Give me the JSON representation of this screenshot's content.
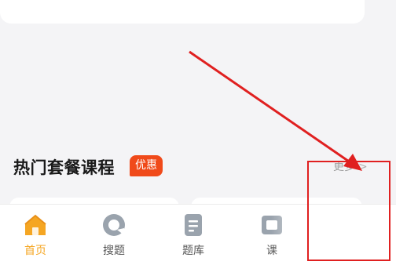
{
  "section": {
    "title": "热门套餐课程",
    "badge": "优惠",
    "more_label": "更多",
    "more_chevron": ">"
  },
  "tabs": [
    {
      "label": "首页",
      "icon": "home-icon",
      "active": true
    },
    {
      "label": "搜题",
      "icon": "search-ring-icon",
      "active": false
    },
    {
      "label": "题库",
      "icon": "document-icon",
      "active": false
    },
    {
      "label": "课",
      "icon": "course-icon",
      "active": false
    }
  ],
  "colors": {
    "accent": "#f5a623",
    "badge": "#f04a1a",
    "annotation": "#e02020",
    "background": "#f4f4f6"
  }
}
